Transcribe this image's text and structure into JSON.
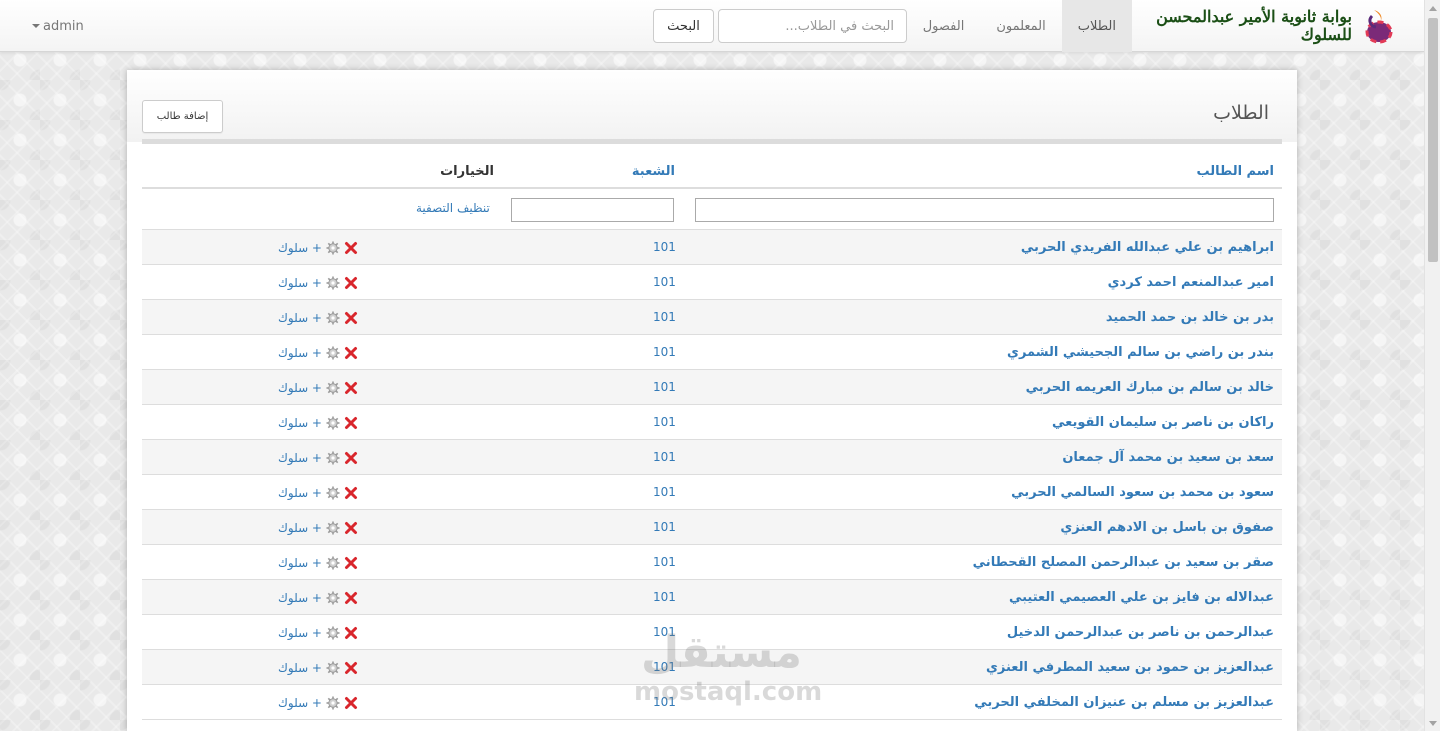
{
  "navbar": {
    "brand_text": "بوابة ثانوية الأمير عبدالمحسن للسلوك",
    "tabs": [
      {
        "label": "الطلاب",
        "active": true
      },
      {
        "label": "المعلمون",
        "active": false
      },
      {
        "label": "الفصول",
        "active": false
      }
    ],
    "search": {
      "placeholder": "البحث في الطلاب...",
      "value": "",
      "button_label": "البحث"
    },
    "user": {
      "label": "admin",
      "icon": "caret-down-icon"
    }
  },
  "panel": {
    "title": "الطلاب",
    "add_button_label": "إضافة طالب",
    "columns": {
      "name": "اسم الطالب",
      "section": "الشعبة",
      "options": "الخيارات"
    },
    "filters": {
      "name_value": "",
      "section_value": "",
      "clear_label": "تنظيف التصفية"
    },
    "row_actions": {
      "add_behavior_label": "+ سلوك",
      "icons": [
        "delete-icon",
        "settings-gear-icon"
      ]
    },
    "rows": [
      {
        "name": "ابراهيم بن علي عبدالله الفريدي الحربي",
        "section": "101"
      },
      {
        "name": "امير عبدالمنعم احمد كردي",
        "section": "101"
      },
      {
        "name": "بدر بن خالد بن حمد الحميد",
        "section": "101"
      },
      {
        "name": "بندر بن راضي بن سالم الجحيشي الشمري",
        "section": "101"
      },
      {
        "name": "خالد بن سالم بن مبارك العريمه الحربي",
        "section": "101"
      },
      {
        "name": "راكان بن ناصر بن سليمان القويعي",
        "section": "101"
      },
      {
        "name": "سعد بن سعيد بن محمد آل جمعان",
        "section": "101"
      },
      {
        "name": "سعود بن محمد بن سعود السالمي الحربي",
        "section": "101"
      },
      {
        "name": "صفوق بن باسل بن الادهم العنزي",
        "section": "101"
      },
      {
        "name": "صقر بن سعيد بن عبدالرحمن المصلح القحطاني",
        "section": "101"
      },
      {
        "name": "عبدالاله بن فايز بن علي العصيمي العتيبي",
        "section": "101"
      },
      {
        "name": "عبدالرحمن بن ناصر بن عبدالرحمن الدخيل",
        "section": "101"
      },
      {
        "name": "عبدالعزيز بن حمود بن سعيد المطرفي العنزي",
        "section": "101"
      },
      {
        "name": "عبدالعزيز بن مسلم بن عنيزان المخلفي الحربي",
        "section": "101"
      }
    ]
  },
  "watermark": {
    "arabic": "مستقل",
    "latin": "mostaql.com"
  },
  "colors": {
    "link": "#337ab7",
    "delete": "#d9262c",
    "brand_text": "#1b4f16",
    "active_tab_bg": "#e7e7e7"
  }
}
